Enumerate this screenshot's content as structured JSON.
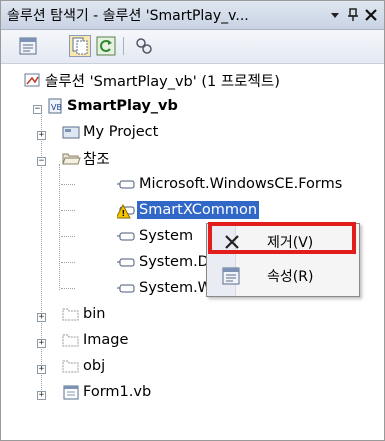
{
  "window": {
    "title": "솔루션 탐색기 - 솔루션 'SmartPlay_v...",
    "dropdown_icon": "chevron-down-icon",
    "pin_icon": "pin-icon",
    "close_icon": "close-icon"
  },
  "toolbar": {
    "buttons": [
      {
        "name": "properties-button",
        "icon": "properties-icon"
      },
      {
        "name": "show-all-files-button",
        "icon": "show-all-files-icon",
        "pressed": true
      },
      {
        "name": "refresh-button",
        "icon": "refresh-icon"
      },
      {
        "name": "class-view-button",
        "icon": "class-view-icon"
      }
    ]
  },
  "tree": {
    "solution": "솔루션 'SmartPlay_vb' (1 프로젝트)",
    "project": "SmartPlay_vb",
    "items": {
      "my_project": "My Project",
      "references": "참조",
      "ref_forms": "Microsoft.WindowsCE.Forms",
      "ref_smartx": "SmartXCommon",
      "ref_system": "System",
      "ref_system_d": "System.D",
      "ref_system_w": "System.W",
      "bin": "bin",
      "image": "Image",
      "obj": "obj",
      "form1": "Form1.vb"
    }
  },
  "context_menu": {
    "items": [
      {
        "label": "제거(V)",
        "icon": "remove-x-icon",
        "highlighted": true
      },
      {
        "label": "속성(R)",
        "icon": "properties-icon"
      }
    ]
  },
  "colors": {
    "selection": "#3168c7",
    "highlight_box": "#e31c1c",
    "titlebar": "#c9d3e3"
  }
}
